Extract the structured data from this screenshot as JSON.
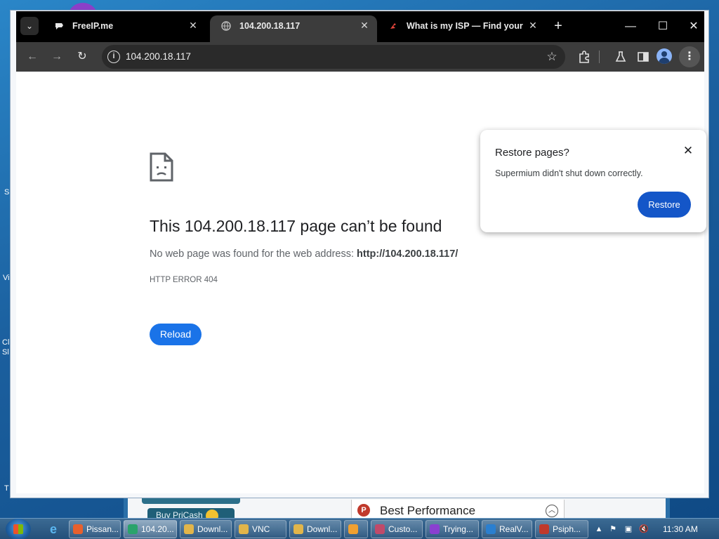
{
  "browser": {
    "tabs": [
      {
        "title": "FreeIP.me",
        "active": false
      },
      {
        "title": "104.200.18.117",
        "active": true
      },
      {
        "title": "What is my ISP — Find your Int",
        "active": false
      }
    ],
    "tab_close_glyph": "✕",
    "new_tab_glyph": "+",
    "window_controls": {
      "minimize": "—",
      "maximize": "☐",
      "close": "✕"
    },
    "address": "104.200.18.117",
    "icons": [
      "back-icon",
      "forward-icon",
      "reload-icon",
      "info-icon",
      "star-icon",
      "extensions-icon",
      "labs-icon",
      "side-panel-icon",
      "profile-icon",
      "menu-icon"
    ]
  },
  "error_page": {
    "title": "This 104.200.18.117 page can’t be found",
    "desc_prefix": "No web page was found for the web address: ",
    "desc_url": "http://104.200.18.117/",
    "code": "HTTP ERROR 404",
    "reload_label": "Reload"
  },
  "restore_popup": {
    "title": "Restore pages?",
    "message": "Supermium didn't shut down correctly.",
    "button": "Restore"
  },
  "background_window": {
    "button_text": "Buy PriCash",
    "best_performance": "Best Performance"
  },
  "taskbar": {
    "tasks": [
      {
        "label": "Pissan...",
        "color": "#e8602c",
        "active": false
      },
      {
        "label": "104.20...",
        "color": "#2aa36b",
        "active": true
      },
      {
        "label": "Downl...",
        "color": "#e2b54a",
        "active": false
      },
      {
        "label": "VNC",
        "color": "#e2b54a",
        "active": false
      },
      {
        "label": "Downl...",
        "color": "#e2b54a",
        "active": false
      },
      {
        "label": "",
        "color": "#f0a030",
        "active": false
      },
      {
        "label": "Custo...",
        "color": "#c04a6a",
        "active": false
      },
      {
        "label": "Trying...",
        "color": "#8a3fd0",
        "active": false
      },
      {
        "label": "RealV...",
        "color": "#2a7fd0",
        "active": false
      },
      {
        "label": "Psiph...",
        "color": "#c0392b",
        "active": false
      }
    ],
    "clock": "11:30 AM"
  }
}
